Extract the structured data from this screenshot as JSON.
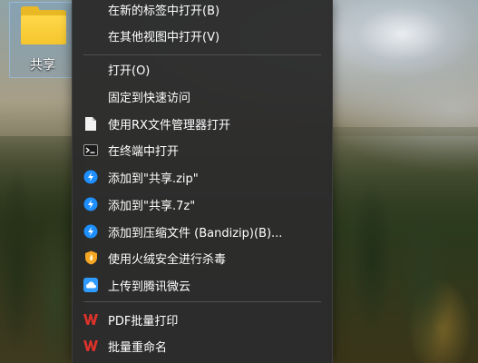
{
  "desktop": {
    "icon_label": "共享"
  },
  "menu": {
    "group1": [
      {
        "label": "在新的标签中打开(B)"
      },
      {
        "label": "在其他视图中打开(V)"
      }
    ],
    "group2": [
      {
        "label": "打开(O)",
        "icon": ""
      },
      {
        "label": "固定到快速访问",
        "icon": ""
      },
      {
        "label": "使用RX文件管理器打开",
        "icon": "document-icon"
      },
      {
        "label": "在终端中打开",
        "icon": "terminal-icon"
      },
      {
        "label": "添加到\"共享.zip\"",
        "icon": "bandizip-icon"
      },
      {
        "label": "添加到\"共享.7z\"",
        "icon": "bandizip-icon"
      },
      {
        "label": "添加到压缩文件 (Bandizip)(B)...",
        "icon": "bandizip-icon"
      },
      {
        "label": "使用火绒安全进行杀毒",
        "icon": "huorong-shield-icon"
      },
      {
        "label": "上传到腾讯微云",
        "icon": "weiyun-cloud-icon"
      }
    ],
    "group3": [
      {
        "label": "PDF批量打印",
        "icon": "wps-icon"
      },
      {
        "label": "批量重命名",
        "icon": "wps-icon"
      }
    ]
  },
  "colors": {
    "menu_bg": "#2b2b2b",
    "menu_text": "#ffffff",
    "separator": "#505050",
    "bandizip_blue": "#1e8fff",
    "wps_red": "#e0322b"
  }
}
